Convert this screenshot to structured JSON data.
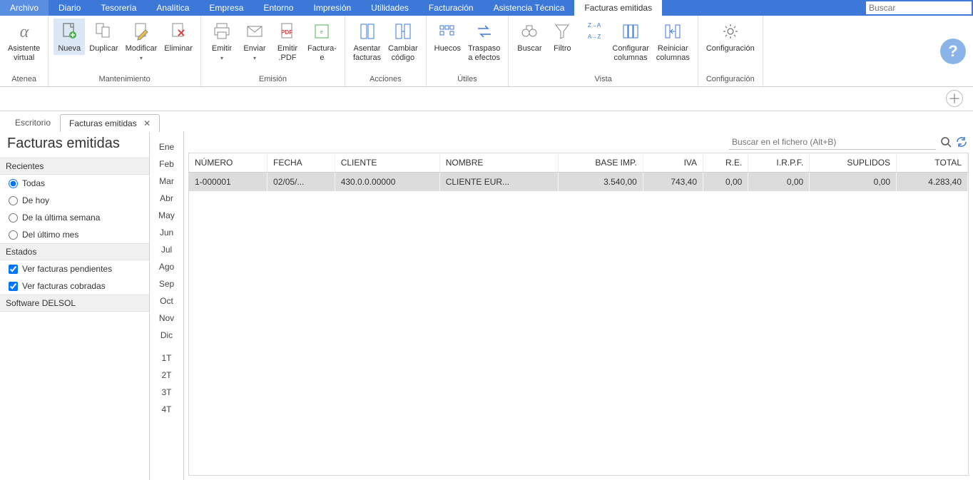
{
  "topmenu": {
    "items": [
      "Archivo",
      "Diario",
      "Tesorería",
      "Analítica",
      "Empresa",
      "Entorno",
      "Impresión",
      "Utilidades",
      "Facturación",
      "Asistencia Técnica"
    ],
    "active": "Facturas emitidas",
    "search_placeholder": "Buscar"
  },
  "ribbon": {
    "groups": [
      {
        "label": "Atenea",
        "buttons": [
          {
            "label": "Asistente\nvirtual",
            "icon": "alpha"
          }
        ]
      },
      {
        "label": "Mantenimiento",
        "buttons": [
          {
            "label": "Nueva",
            "icon": "doc-new",
            "active": true
          },
          {
            "label": "Duplicar",
            "icon": "doc-dup"
          },
          {
            "label": "Modificar",
            "icon": "doc-edit",
            "dd": true
          },
          {
            "label": "Eliminar",
            "icon": "doc-del"
          }
        ]
      },
      {
        "label": "Emisión",
        "buttons": [
          {
            "label": "Emitir",
            "icon": "printer",
            "dd": true
          },
          {
            "label": "Enviar",
            "icon": "envelope",
            "dd": true
          },
          {
            "label": "Emitir\n.PDF",
            "icon": "pdf"
          },
          {
            "label": "Factura-\ne",
            "icon": "xml"
          }
        ]
      },
      {
        "label": "Acciones",
        "buttons": [
          {
            "label": "Asentar\nfacturas",
            "icon": "book"
          },
          {
            "label": "Cambiar\ncódigo",
            "icon": "code"
          }
        ]
      },
      {
        "label": "Útiles",
        "buttons": [
          {
            "label": "Huecos",
            "icon": "gaps"
          },
          {
            "label": "Traspaso\na efectos",
            "icon": "transfer"
          }
        ]
      },
      {
        "label": "Vista",
        "buttons": [
          {
            "label": "Buscar",
            "icon": "binocs"
          },
          {
            "label": "Filtro",
            "icon": "funnel"
          },
          {
            "label": "",
            "icon": "sort",
            "narrow": true
          },
          {
            "label": "Configurar\ncolumnas",
            "icon": "cols-cfg"
          },
          {
            "label": "Reiniciar\ncolumnas",
            "icon": "cols-reset"
          }
        ]
      },
      {
        "label": "Configuración",
        "buttons": [
          {
            "label": "Configuración",
            "icon": "gear"
          }
        ]
      }
    ]
  },
  "doctabs": {
    "items": [
      {
        "label": "Escritorio",
        "active": false,
        "closable": false
      },
      {
        "label": "Facturas emitidas",
        "active": true,
        "closable": true
      }
    ]
  },
  "sidebar": {
    "title": "Facturas emitidas",
    "recents_label": "Recientes",
    "recents": [
      {
        "label": "Todas",
        "checked": true
      },
      {
        "label": "De hoy",
        "checked": false
      },
      {
        "label": "De la última semana",
        "checked": false
      },
      {
        "label": "Del último mes",
        "checked": false
      }
    ],
    "states_label": "Estados",
    "states": [
      {
        "label": "Ver facturas pendientes",
        "checked": true
      },
      {
        "label": "Ver facturas cobradas",
        "checked": true
      }
    ],
    "footer_label": "Software DELSOL"
  },
  "months": [
    "Ene",
    "Feb",
    "Mar",
    "Abr",
    "May",
    "Jun",
    "Jul",
    "Ago",
    "Sep",
    "Oct",
    "Nov",
    "Dic"
  ],
  "quarters": [
    "1T",
    "2T",
    "3T",
    "4T"
  ],
  "grid": {
    "search_placeholder": "Buscar en el fichero (Alt+B)",
    "cols": [
      "NÚMERO",
      "FECHA",
      "CLIENTE",
      "NOMBRE",
      "BASE IMP.",
      "IVA",
      "R.E.",
      "I.R.P.F.",
      "SUPLIDOS",
      "TOTAL"
    ],
    "rows": [
      {
        "numero": "1-000001",
        "fecha": "02/05/...",
        "cliente": "430.0.0.00000",
        "nombre": "CLIENTE EUR...",
        "base": "3.540,00",
        "iva": "743,40",
        "re": "0,00",
        "irpf": "0,00",
        "suplidos": "0,00",
        "total": "4.283,40"
      }
    ]
  }
}
